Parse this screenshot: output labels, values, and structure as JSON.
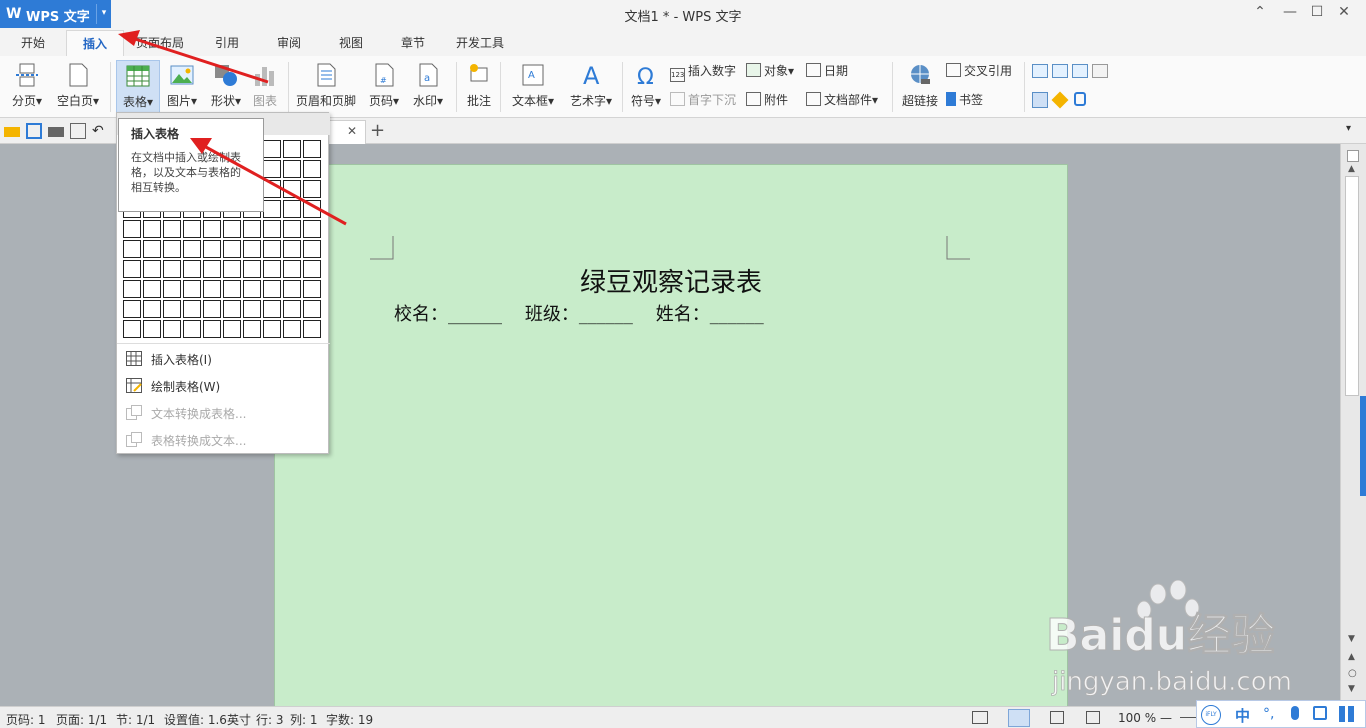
{
  "app": {
    "menu_label": "WPS 文字",
    "window_title": "文档1 * - WPS 文字"
  },
  "tabs": [
    "开始",
    "插入",
    "页面布局",
    "引用",
    "审阅",
    "视图",
    "章节",
    "开发工具"
  ],
  "ribbon": {
    "page_break": "分页",
    "blank_page": "空白页",
    "table": "表格",
    "picture": "图片",
    "shape": "形状",
    "chart": "图表",
    "header_footer": "页眉和页脚",
    "page_number": "页码",
    "watermark": "水印",
    "comment": "批注",
    "textbox": "文本框",
    "wordart": "艺术字",
    "symbol": "符号",
    "insert_number": "插入数字",
    "drop_cap": "首字下沉",
    "object": "对象",
    "attachment": "附件",
    "date": "日期",
    "doc_parts": "文档部件",
    "hyperlink": "超链接",
    "cross_ref": "交叉引用",
    "bookmark": "书签"
  },
  "dropdown": {
    "items": [
      {
        "label": "插入表格(I)",
        "enabled": true
      },
      {
        "label": "绘制表格(W)",
        "enabled": true
      },
      {
        "label": "文本转换成表格...",
        "enabled": false
      },
      {
        "label": "表格转换成文本...",
        "enabled": false
      }
    ]
  },
  "tooltip": {
    "title": "插入表格",
    "desc": "在文档中插入或绘制表格，以及文本与表格的相互转换。"
  },
  "document": {
    "title": "绿豆观察记录表",
    "line": "校名：______    班级：______    姓名：______"
  },
  "status": {
    "page_num": "页码: 1",
    "pages": "页面: 1/1",
    "section": "节: 1/1",
    "setting": "设置值: 1.6英寸",
    "row": "行: 3",
    "col": "列: 1",
    "words": "字数: 19",
    "zoom": "100 %"
  },
  "ime": {
    "logo": "iFLY",
    "lang": "中"
  },
  "watermark": {
    "brand": "Baidu经验",
    "url": "jingyan.baidu.com"
  },
  "colors": {
    "accent": "#2e7bd6",
    "page_bg": "#c8ecca",
    "arrow": "#e02020"
  }
}
